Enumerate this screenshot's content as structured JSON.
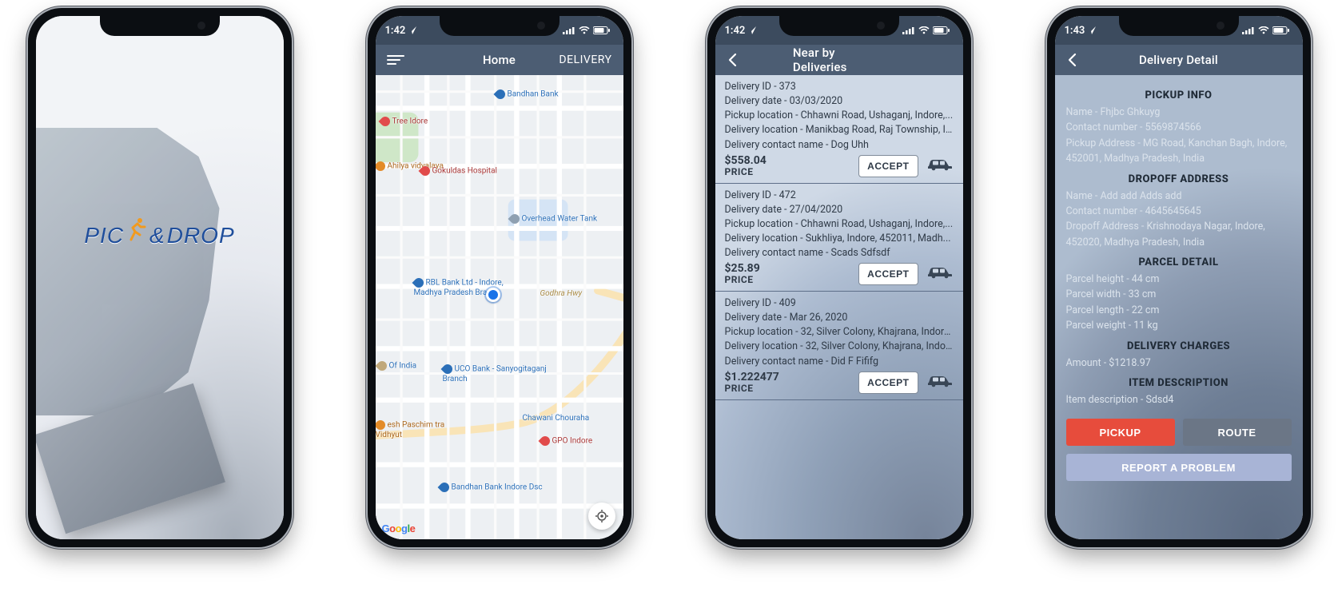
{
  "status": {
    "time_a": "1:42",
    "time_b": "1:43"
  },
  "splash": {
    "logo_pic": "PIC",
    "logo_amp": "&",
    "logo_drop": "DROP"
  },
  "home": {
    "title": "Home",
    "role": "DELIVERY",
    "pois": {
      "tree": "Tree Idore",
      "ahilya": "Ahilya vidyalaya",
      "bandhan": "Bandhan Bank",
      "gokuldas": "Gokuldas Hospital",
      "water": "Overhead Water Tank",
      "rbl": "RBL Bank Ltd - Indore, Madhya Pradesh Branch",
      "godhra": "Godhra Hwy",
      "ofindia": "Of India",
      "uco": "UCO Bank - Sanyogitaganj Branch",
      "chawani": "Chawani Chouraha",
      "gpo": "GPO Indore",
      "paschim": "esh Paschim tra Vidhyut",
      "bandhan2": "Bandhan Bank Indore Dsc"
    },
    "google": "Google"
  },
  "deliveries": {
    "title": "Near by Deliveries",
    "label_id": "Delivery ID",
    "label_date": "Delivery date",
    "label_pickup": "Pickup location",
    "label_dropoff": "Delivery location",
    "label_contact": "Delivery contact name",
    "price_label": "PRICE",
    "accept_label": "ACCEPT",
    "items": [
      {
        "id": "373",
        "date": "03/03/2020",
        "pickup": "Chhawni Road, Ushaganj, Indore,...",
        "dropoff": "Manikbag Road, Raj Township, In...",
        "contact": "Dog Uhh",
        "price": "$558.04"
      },
      {
        "id": "472",
        "date": "27/04/2020",
        "pickup": "Chhawni Road, Ushaganj, Indore,...",
        "dropoff": "Sukhliya, Indore, 452011, Madh...",
        "contact": "Scads Sdfsdf",
        "price": "$25.89"
      },
      {
        "id": "409",
        "date": "Mar 26, 2020",
        "pickup": "32, Silver Colony, Khajrana, Indore...",
        "dropoff": "32, Silver Colony, Khajrana, Indor...",
        "contact": "Did F Fififg",
        "price": "$1.222477"
      }
    ]
  },
  "detail": {
    "title": "Delivery Detail",
    "sec_pickup": "PICKUP INFO",
    "sec_dropoff": "DROPOFF ADDRESS",
    "sec_parcel": "PARCEL DETAIL",
    "sec_charges": "DELIVERY CHARGES",
    "sec_desc": "ITEM DESCRIPTION",
    "pickup_name": "Name - Fhjbc Ghkuyg",
    "pickup_contact": "Contact number - 5569874566",
    "pickup_addr": "Pickup Address - MG Road, Kanchan Bagh, Indore, 452001, Madhya Pradesh, India",
    "drop_name": "Name - Add add Adds add",
    "drop_contact": "Contact number - 4645645645",
    "drop_addr": "Dropoff Address - Krishnodaya Nagar, Indore, 452020, Madhya Pradesh, India",
    "parcel_h": "Parcel height - 44 cm",
    "parcel_w": "Parcel width - 33 cm",
    "parcel_l": "Parcel length - 22 cm",
    "parcel_wt": "Parcel weight - 11 kg",
    "amount": "Amount - $1218.97",
    "item_desc": "Item description - Sdsd4",
    "btn_pickup": "PICKUP",
    "btn_route": "ROUTE",
    "btn_report": "REPORT A PROBLEM"
  }
}
